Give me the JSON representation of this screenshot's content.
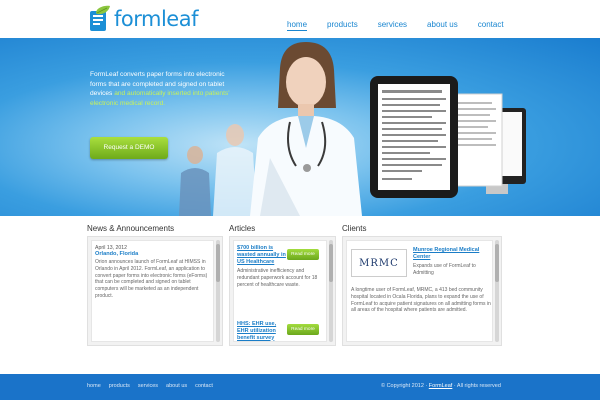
{
  "brand": {
    "name": "formleaf"
  },
  "nav": [
    "home",
    "products",
    "services",
    "about us",
    "contact"
  ],
  "hero": {
    "text_1": "FormLeaf converts paper forms into electronic forms that are completed and signed on tablet devices ",
    "text_highlight": "and automatically inserted into patients' electronic medical record.",
    "button": "Request a DEMO"
  },
  "sections": {
    "news": {
      "title": "News & Announcements",
      "date": "April 13, 2012",
      "location": "Orlando, Florida",
      "body": "Orion announces launch of FormLeaf at HIMSS in Orlando in April 2012. FormLeaf, an application to convert paper forms into electronic forms (eForms) that can be completed and signed on tablet computers will be marketed as an independent product."
    },
    "articles": {
      "title": "Articles",
      "item1_title": "$700 billion is wasted annually in US Healthcare",
      "item1_body": "Administrative inefficiency and redundant paperwork account for 18 percent of healthcare waste.",
      "item2_title": "HHS: EHR use, EHR utilization benefit survey",
      "read_more": "Read more"
    },
    "clients": {
      "title": "Clients",
      "logo_text": "MRMC",
      "client_name": "Munroe Regional Medical Center",
      "client_desc": "Expands use of FormLeaf to Admitting",
      "body": "A longtime user of FormLeaf, MRMC, a 413 bed community hospital located in Ocala Florida, plans to expand the use of FormLeaf to acquire patient signatures on all admitting forms in all areas of the hospital where patients are admitted."
    }
  },
  "footer": {
    "links": [
      "home",
      "products",
      "services",
      "about us",
      "contact"
    ],
    "copyright": "© Copyright 2012 · ",
    "copyright_link": "FormLeaf",
    "rights": " · All rights reserved"
  },
  "colors": {
    "brand_blue": "#1a86d0",
    "accent_green": "#8cc63f",
    "footer_blue": "#1a73c9"
  }
}
